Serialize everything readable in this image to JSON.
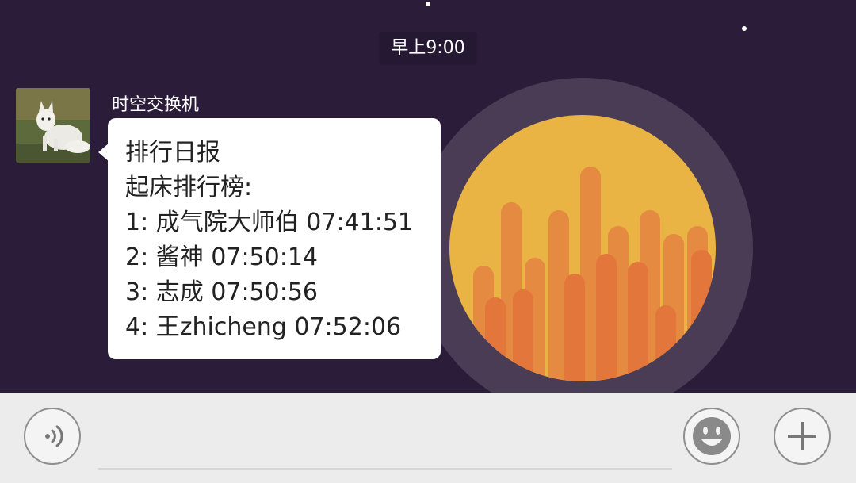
{
  "chat": {
    "time_label": "早上9:00",
    "message": {
      "sender": "时空交换机",
      "lines": [
        "排行日报",
        "起床排行榜:",
        "1: 成气院大师伯 07:41:51",
        "2: 酱神 07:50:14",
        "3: 志成 07:50:56",
        "4: 王zhicheng 07:52:06"
      ]
    }
  },
  "input_bar": {
    "voice_icon": "voice-icon",
    "emoji_icon": "emoji-icon",
    "plus_icon": "plus-icon",
    "text_value": ""
  },
  "colors": {
    "background": "#2b1d3a",
    "bubble": "#ffffff",
    "input_bar": "#ececec",
    "wallpaper_yellow": "#e9b443",
    "wallpaper_orange": "#e3763a"
  }
}
